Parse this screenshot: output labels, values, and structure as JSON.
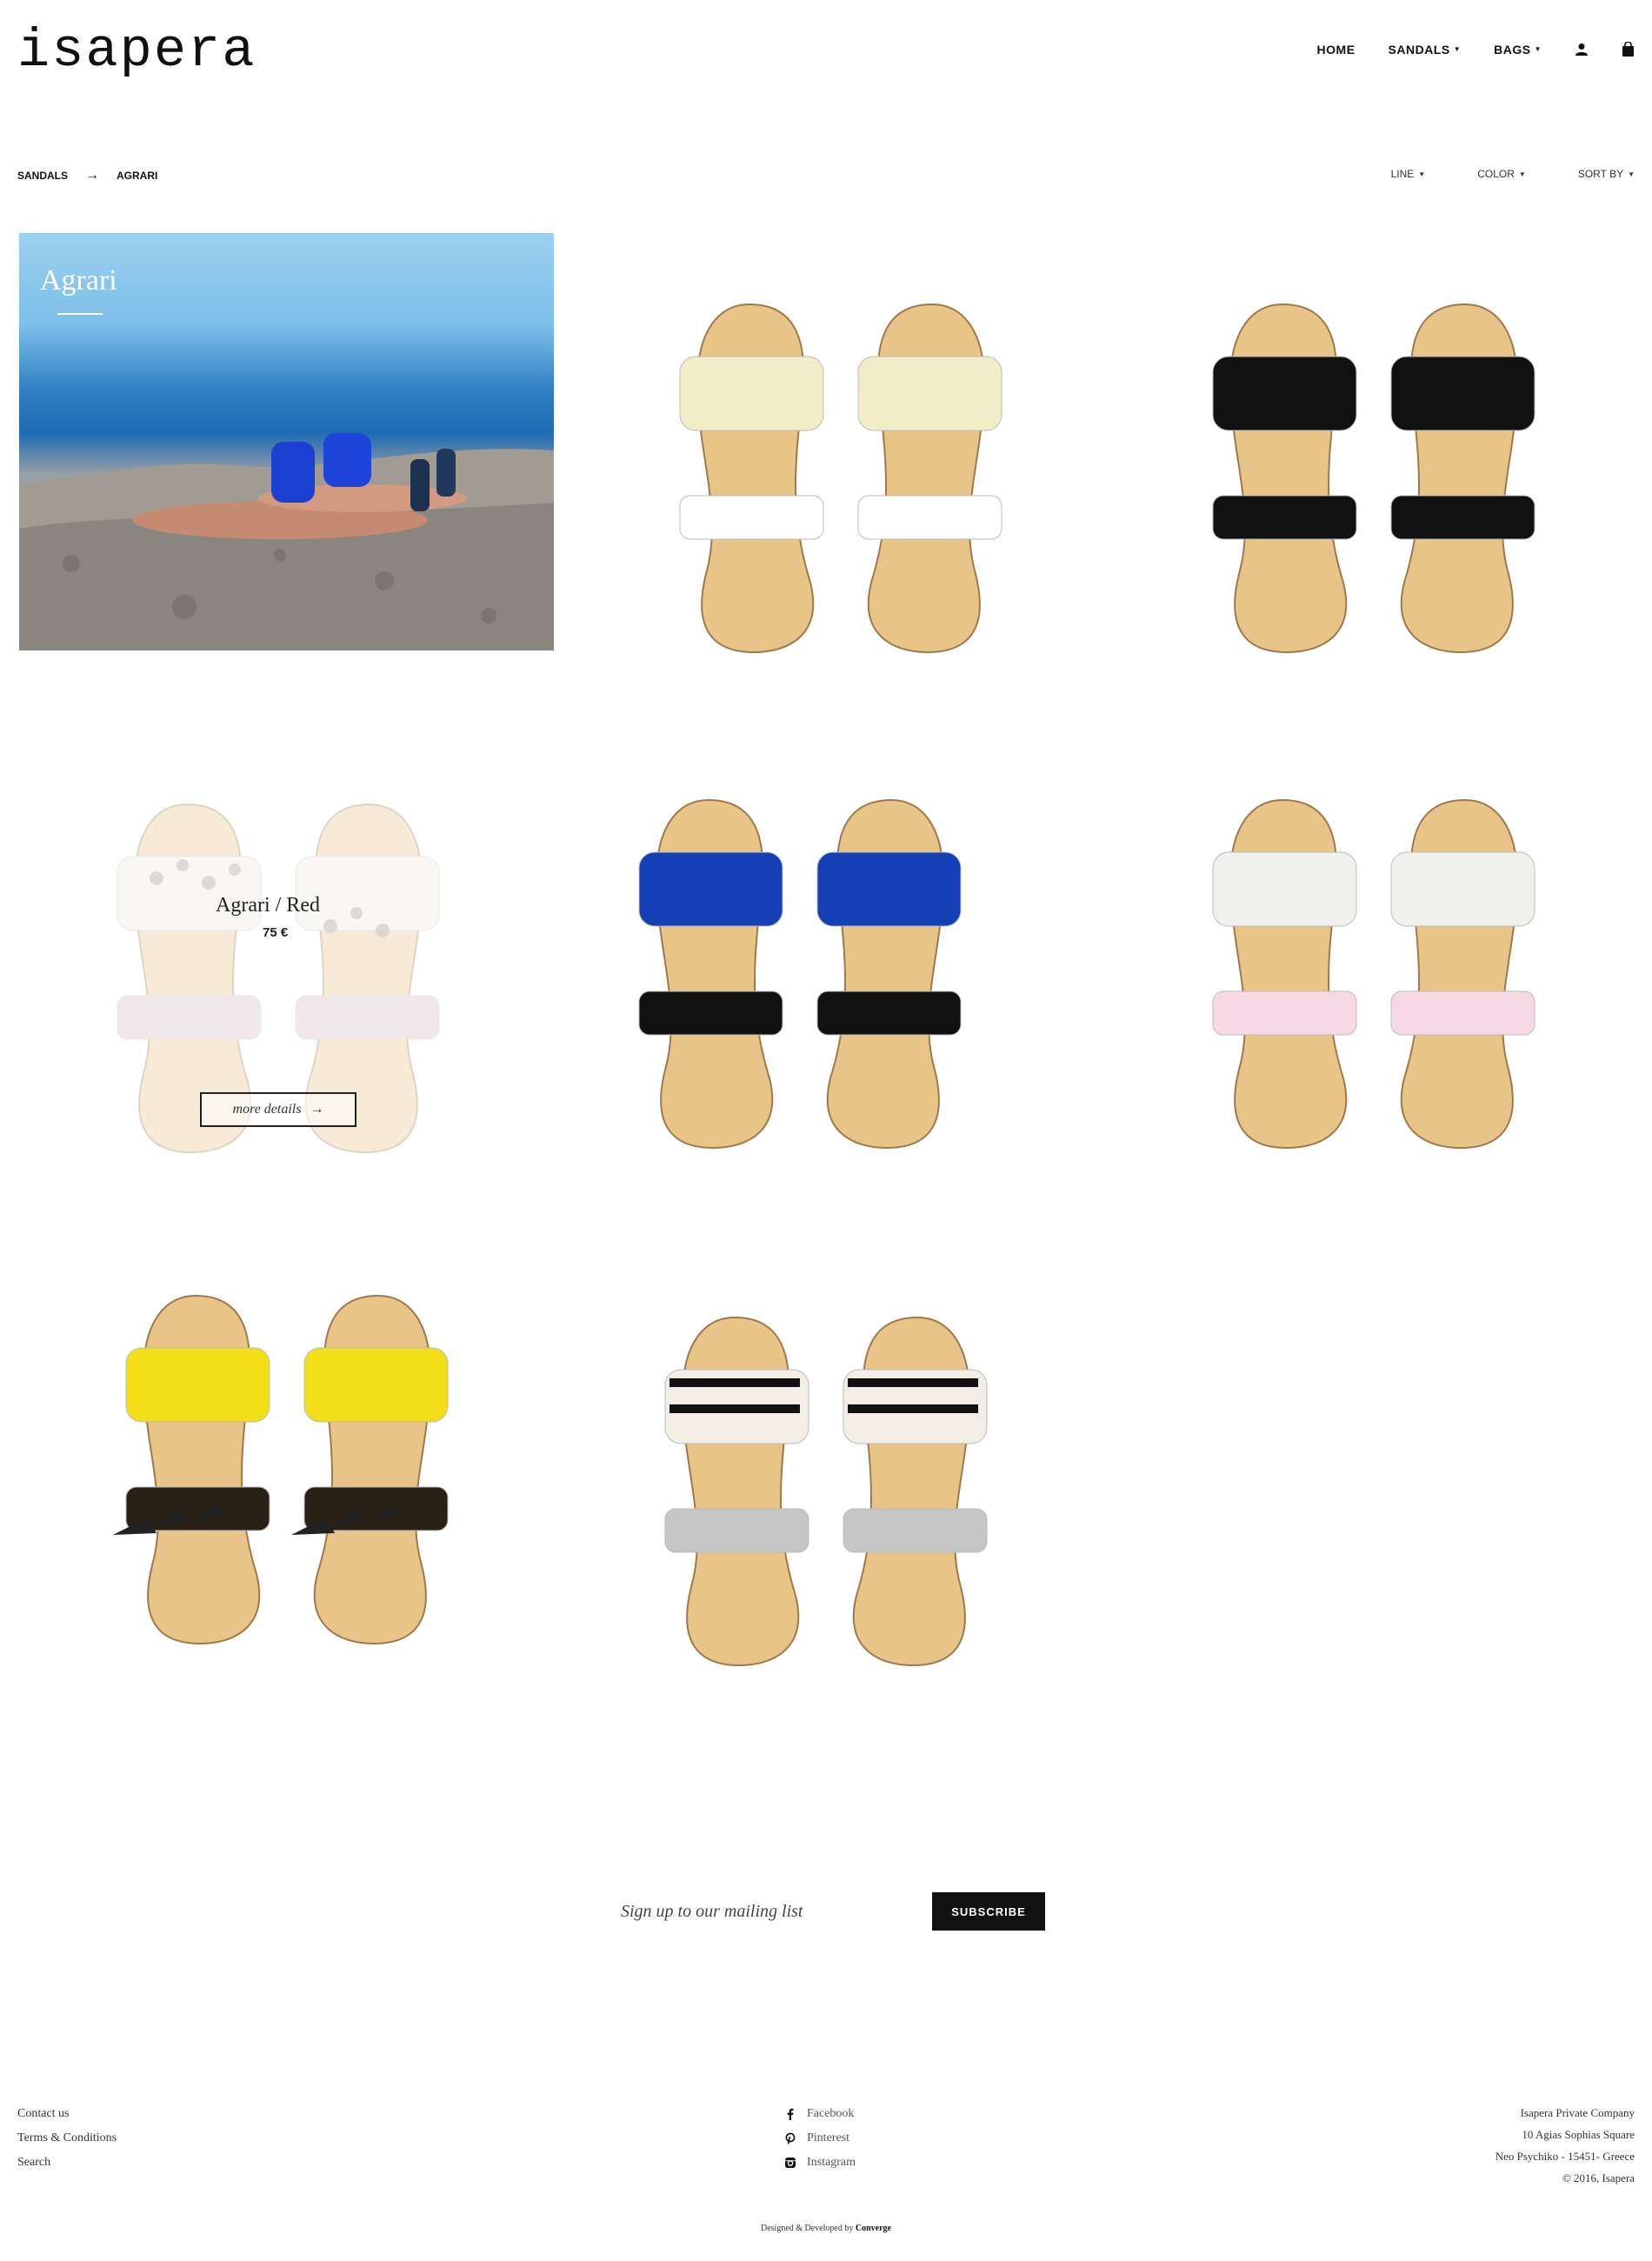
{
  "header": {
    "logo": "isapera",
    "nav": [
      {
        "label": "HOME",
        "has_caret": false
      },
      {
        "label": "SANDALS",
        "has_caret": true
      },
      {
        "label": "BAGS",
        "has_caret": true
      }
    ],
    "icons": [
      "user-icon",
      "bag-icon"
    ]
  },
  "breadcrumb": {
    "items": [
      "SANDALS",
      "AGRARI"
    ],
    "separator": "→"
  },
  "filters": [
    {
      "label": "LINE"
    },
    {
      "label": "COLOR"
    },
    {
      "label": "SORT BY"
    }
  ],
  "hero": {
    "title": "Agrari"
  },
  "products": [
    {
      "colors": {
        "top": "#f2ecc7",
        "toe": "#ffffff"
      }
    },
    {
      "colors": {
        "top": "#111111",
        "toe": "#111111"
      }
    },
    {
      "name": "Agrari / Red",
      "price": "75 €",
      "more": "more details",
      "colors": {
        "top": "#ece7df",
        "toe": "#d2b8bf"
      }
    },
    {
      "colors": {
        "top": "#1540b5",
        "toe": "#111111"
      }
    },
    {
      "colors": {
        "top": "#f0f0ec",
        "toe": "#f6d9e5"
      }
    },
    {
      "colors": {
        "top": "#f4de18",
        "toe": "#2a2015"
      }
    },
    {
      "colors": {
        "top": "#f2eee6",
        "toe": "#c6c6c6"
      }
    }
  ],
  "mailing": {
    "placeholder": "Sign up to our mailing list",
    "button": "SUBSCRIBE"
  },
  "footer": {
    "links": [
      "Contact us",
      "Terms & Conditions",
      "Search"
    ],
    "social": [
      {
        "label": "Facebook",
        "icon": "facebook-icon"
      },
      {
        "label": "Pinterest",
        "icon": "pinterest-icon"
      },
      {
        "label": "Instagram",
        "icon": "instagram-icon"
      }
    ],
    "address": [
      "Isapera Private Company",
      "10 Agias Sophias Square",
      "Neo Psychiko - 15451- Greece",
      "© 2016, Isapera"
    ],
    "credit_prefix": "Designed & Developed by",
    "credit_name": "Converge"
  },
  "theme": {
    "accent": "#111111",
    "sole": "#e8c489",
    "sky": "#2e7ec2"
  }
}
